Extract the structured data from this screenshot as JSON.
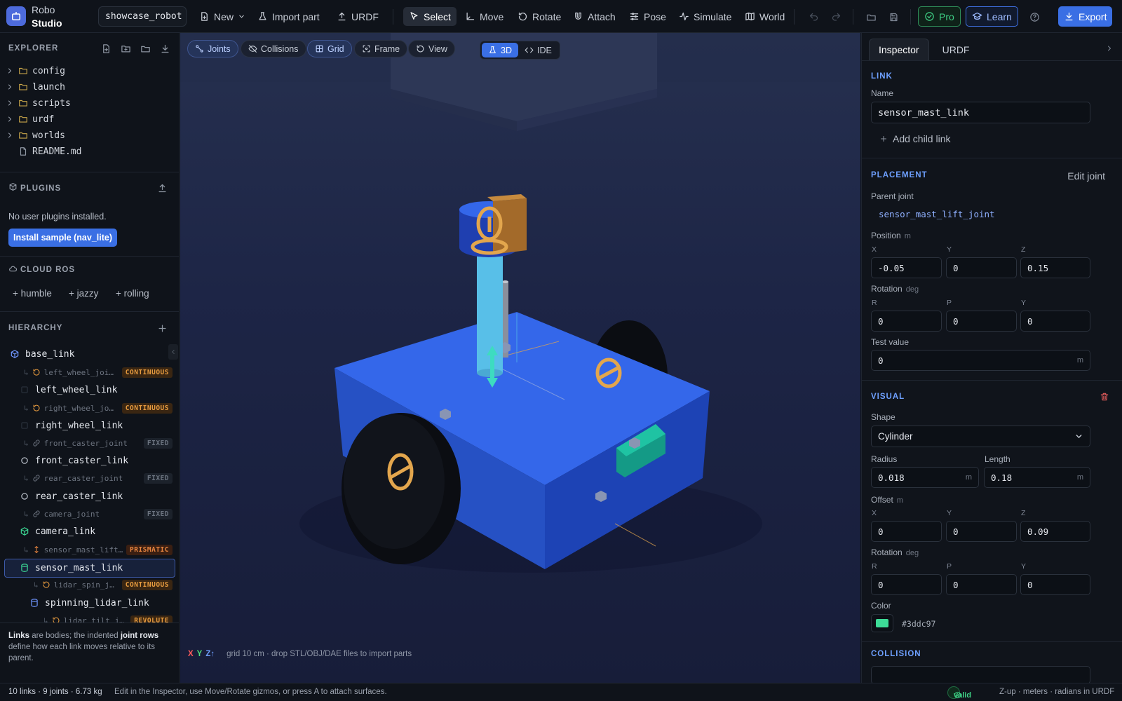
{
  "app": {
    "name_line1": "Robo",
    "name_line2": "Studio",
    "project": "showcase_robot"
  },
  "toolbar": {
    "new": "New",
    "import_part": "Import part",
    "urdf": "URDF",
    "select": "Select",
    "move": "Move",
    "rotate": "Rotate",
    "attach": "Attach",
    "pose": "Pose",
    "simulate": "Simulate",
    "world": "World",
    "pro": "Pro",
    "learn": "Learn",
    "export": "Export"
  },
  "explorer": {
    "title": "EXPLORER",
    "items": [
      {
        "name": "config",
        "type": "folder"
      },
      {
        "name": "launch",
        "type": "folder"
      },
      {
        "name": "scripts",
        "type": "folder"
      },
      {
        "name": "urdf",
        "type": "folder"
      },
      {
        "name": "worlds",
        "type": "folder"
      },
      {
        "name": "README.md",
        "type": "file"
      }
    ]
  },
  "plugins": {
    "title": "PLUGINS",
    "empty": "No user plugins installed.",
    "install_button": "Install sample (nav_lite)"
  },
  "cloud_ros": {
    "title": "CLOUD ROS",
    "distros": [
      "+ humble",
      "+ jazzy",
      "+ rolling"
    ]
  },
  "hierarchy": {
    "title": "HIERARCHY",
    "rows": [
      {
        "kind": "link",
        "name": "base_link",
        "icon": "cube-icon"
      },
      {
        "kind": "joint",
        "name": "left_wheel_joi…",
        "type": "CONTINUOUS"
      },
      {
        "kind": "link",
        "name": "left_wheel_link",
        "icon": "square-icon"
      },
      {
        "kind": "joint",
        "name": "right_wheel_jo…",
        "type": "CONTINUOUS"
      },
      {
        "kind": "link",
        "name": "right_wheel_link",
        "icon": "square-icon"
      },
      {
        "kind": "joint",
        "name": "front_caster_joint",
        "type": "FIXED"
      },
      {
        "kind": "link",
        "name": "front_caster_link",
        "icon": "circle-icon"
      },
      {
        "kind": "joint",
        "name": "rear_caster_joint",
        "type": "FIXED"
      },
      {
        "kind": "link",
        "name": "rear_caster_link",
        "icon": "circle-icon"
      },
      {
        "kind": "joint",
        "name": "camera_joint",
        "type": "FIXED"
      },
      {
        "kind": "link",
        "name": "camera_link",
        "icon": "cube-icon"
      },
      {
        "kind": "joint",
        "name": "sensor_mast_lift…",
        "type": "PRISMATIC"
      },
      {
        "kind": "link",
        "name": "sensor_mast_link",
        "icon": "cylinder-icon",
        "selected": true
      },
      {
        "kind": "joint",
        "name": "lidar_spin_j…",
        "type": "CONTINUOUS"
      },
      {
        "kind": "link",
        "name": "spinning_lidar_link",
        "icon": "cylinder-icon"
      },
      {
        "kind": "joint",
        "name": "lidar_tilt_j…",
        "type": "REVOLUTE"
      }
    ],
    "footer_bold1": "Links",
    "footer_t1": " are bodies; the indented ",
    "footer_bold2": "joint rows",
    "footer_t2": " define how each link moves relative to its parent."
  },
  "viewport": {
    "toggles": [
      "Joints",
      "Collisions",
      "Grid",
      "Frame",
      "View"
    ],
    "mode_3d": "3D",
    "mode_ide": "IDE",
    "axis_x": "X",
    "axis_y": "Y",
    "axis_z": "Z↑",
    "grid_info": "grid 10 cm · drop STL/OBJ/DAE files to import parts",
    "colors": {
      "base": "#2f5fe0",
      "wheel": "#0b0d12",
      "mast": "#58bfe8",
      "sensor": "#3ddc97",
      "gizmo": "#e3a64d"
    }
  },
  "inspector": {
    "tabs": [
      "Inspector",
      "URDF"
    ],
    "link_section": "LINK",
    "name_label": "Name",
    "name_value": "sensor_mast_link",
    "add_child": "Add child link",
    "placement_section": "PLACEMENT",
    "edit_joint": "Edit joint",
    "parent_joint_label": "Parent joint",
    "parent_joint": "sensor_mast_lift_joint",
    "position_label": "Position",
    "position_unit": "m",
    "position": {
      "x": "-0.05",
      "y": "0",
      "z": "0.15"
    },
    "rotation_label": "Rotation",
    "rotation_unit": "deg",
    "rotation": {
      "r": "0",
      "p": "0",
      "y": "0"
    },
    "test_value_label": "Test value",
    "test_value": "0",
    "test_unit": "m",
    "visual_section": "VISUAL",
    "shape_label": "Shape",
    "shape": "Cylinder",
    "radius_label": "Radius",
    "radius": "0.018",
    "length_label": "Length",
    "length": "0.18",
    "offset_label": "Offset",
    "offset_unit": "m",
    "offset": {
      "x": "0",
      "y": "0",
      "z": "0.09"
    },
    "vrotation": {
      "r": "0",
      "p": "0",
      "y": "0"
    },
    "color_label": "Color",
    "color": "#3ddc97",
    "collision_section": "COLLISION",
    "x": "X",
    "y": "Y",
    "z": "Z",
    "r": "R",
    "p": "P",
    "m": "m"
  },
  "statusbar": {
    "summary": "10 links · 9 joints · 6.73 kg",
    "hint": "Edit in the Inspector, use Move/Rotate gizmos, or press A to attach surfaces.",
    "valid": "valid",
    "units": "Z-up · meters · radians in URDF"
  }
}
